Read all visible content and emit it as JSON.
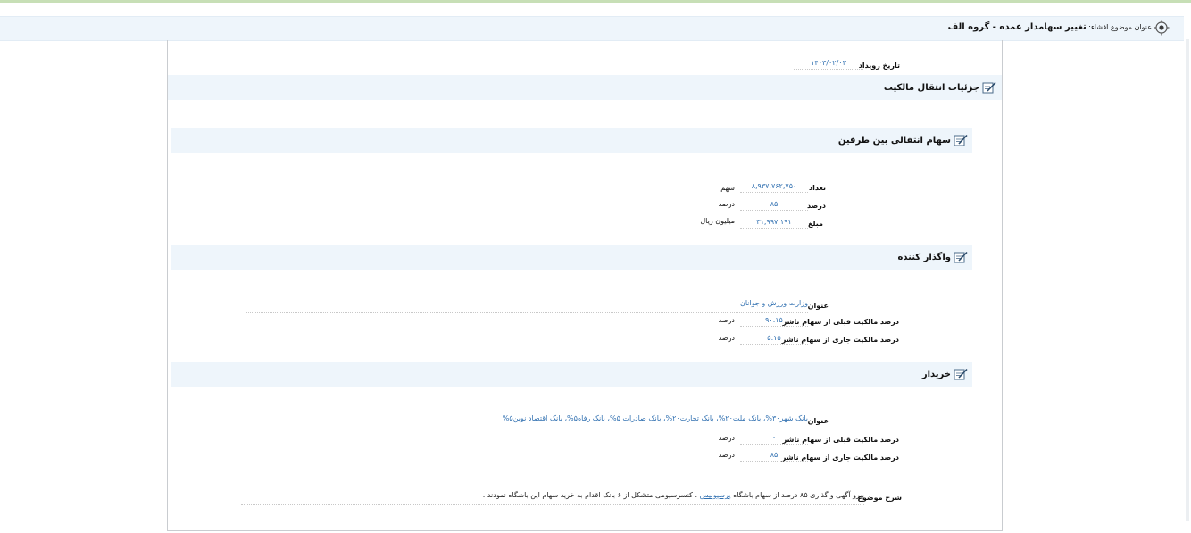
{
  "page": {
    "title_prefix": "عنوان موضوع افشاء:",
    "title": "تغییر سهامدار عمده - گروه الف"
  },
  "event": {
    "date_label": "تاریخ رویداد",
    "date_value": "۱۴۰۳/۰۲/۰۳"
  },
  "sections": {
    "ownership": "جزئیات انتقال مالکیت",
    "shares": "سهام انتقالی بین طرفین",
    "seller": "واگذار کننده",
    "buyer": "خریدار"
  },
  "shares": {
    "count_label": "تعداد",
    "count_value": "۸,۹۳۷,۷۶۲,۷۵۰",
    "count_unit": "سهم",
    "percent_label": "درصد",
    "percent_value": "۸۵",
    "percent_unit": "درصد",
    "amount_label": "مبلغ",
    "amount_value": "۳۱,۹۹۷,۱۹۱",
    "amount_unit": "میلیون ریال"
  },
  "seller": {
    "name_label": "عنوان",
    "name_value": "وزارت ورزش و جوانان",
    "prev_label": "درصد مالکیت قبلی از سهام ناشر",
    "prev_value": "۹۰.۱۵",
    "prev_unit": "درصد",
    "curr_label": "درصد مالکیت جاری از سهام ناشر",
    "curr_value": "۵.۱۵",
    "curr_unit": "درصد"
  },
  "buyer": {
    "name_label": "عنوان",
    "name_value": "بانک شهر۳۰%، بانک ملت۲۰%، بانک تجارت۲۰%، بانک صادرات ۵%، بانک رفاه۵%، بانک اقتصاد نوین۵%",
    "prev_label": "درصد مالکیت قبلی از سهام ناشر",
    "prev_value": "۰",
    "prev_unit": "درصد",
    "curr_label": "درصد مالکیت جاری از سهام ناشر",
    "curr_value": "۸۵",
    "curr_unit": "درصد"
  },
  "description": {
    "label": "شرح موضوع",
    "text_before": "پیرو آگهی واگذاری ۸۵ درصد از سهام باشگاه",
    "link_text": "پرسپولیس",
    "text_after": "، کنسرسیومی متشکل از ۶ بانک اقدام به خرید سهام این باشگاه نمودند ."
  },
  "icons": {
    "title_icon": "target-icon",
    "section_icon": "edit-note-icon"
  },
  "colors": {
    "section_bg": "#eef5fb",
    "value_text": "#2f6fb0",
    "top_line": "#c7dfb6"
  }
}
